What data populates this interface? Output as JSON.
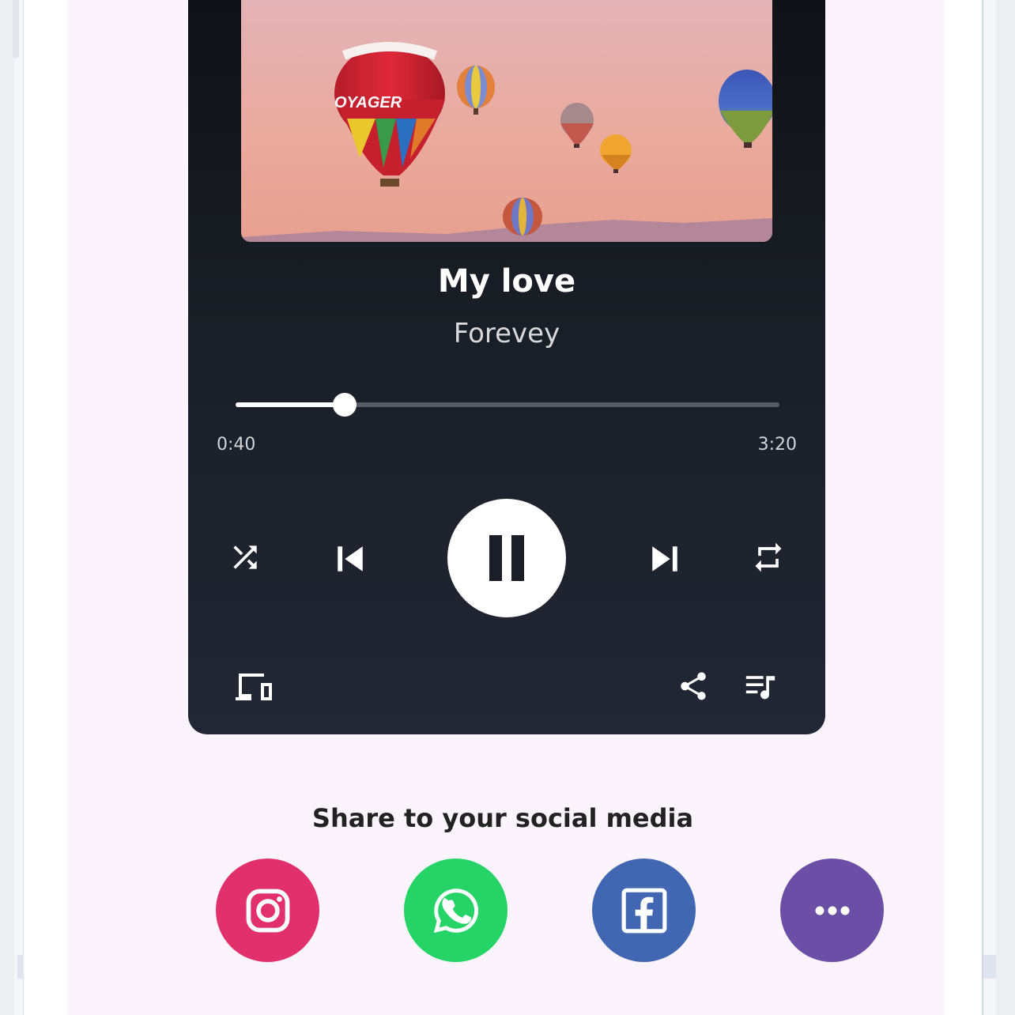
{
  "player": {
    "track_title": "My love",
    "track_artist": "Forevey",
    "elapsed_time": "0:40",
    "total_time": "3:20",
    "progress_fraction": 0.2,
    "is_playing": true
  },
  "artwork": {
    "balloon_text": "OYAGER"
  },
  "icons": {
    "shuffle": "shuffle-icon",
    "previous": "skip-previous-icon",
    "play_pause": "pause-icon",
    "next": "skip-next-icon",
    "repeat": "repeat-icon",
    "devices": "devices-icon",
    "share": "share-icon",
    "queue": "queue-music-icon"
  },
  "share_section": {
    "label": "Share to your social media",
    "targets": [
      {
        "name": "instagram",
        "icon": "instagram-icon",
        "color": "#e1306c"
      },
      {
        "name": "whatsapp",
        "icon": "whatsapp-icon",
        "color": "#25d366"
      },
      {
        "name": "facebook",
        "icon": "facebook-icon",
        "color": "#4267b2"
      },
      {
        "name": "more",
        "icon": "more-horizontal-icon",
        "color": "#6b4fa6"
      }
    ]
  },
  "colors": {
    "player_background": "#1a1e26",
    "page_background": "#fcf4fd",
    "accent": "#ffffff"
  }
}
